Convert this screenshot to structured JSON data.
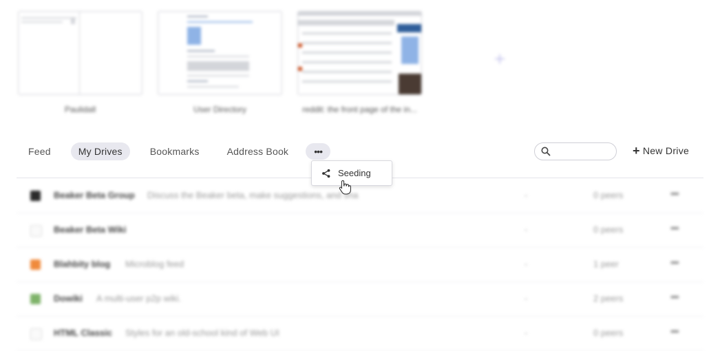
{
  "thumbnails": [
    {
      "label": "Paulidall"
    },
    {
      "label": "User Directory"
    },
    {
      "label": "reddit: the front page of the in..."
    }
  ],
  "add_thumbnail_icon": "plus-icon",
  "nav": {
    "tabs": [
      "Feed",
      "My Drives",
      "Bookmarks",
      "Address Book"
    ],
    "active": "My Drives",
    "more_icon": "•••"
  },
  "search": {
    "placeholder": ""
  },
  "new_drive": {
    "plus": "+",
    "label": "New Drive"
  },
  "dropdown": {
    "items": [
      {
        "icon": "share-icon",
        "label": "Seeding"
      }
    ]
  },
  "drives": [
    {
      "title": "Beaker Beta Group",
      "description": "Discuss the Beaker beta, make suggestions, and sha",
      "dash": "-",
      "peers": "0 peers",
      "menu": "•••",
      "icon_color": "#2b2b2b"
    },
    {
      "title": "Beaker Beta Wiki",
      "description": "",
      "dash": "-",
      "peers": "0 peers",
      "menu": "•••",
      "icon_color": "#f0f0f0"
    },
    {
      "title": "Blahbity blog",
      "description": "Microblog feed",
      "dash": "-",
      "peers": "1 peer",
      "menu": "•••",
      "icon_color": "#f08a3c"
    },
    {
      "title": "Dowiki",
      "description": "A multi-user p2p wiki.",
      "dash": "-",
      "peers": "2 peers",
      "menu": "•••",
      "icon_color": "#7fb36a"
    },
    {
      "title": "HTML Classic",
      "description": "Styles for an old-school kind of Web UI",
      "dash": "-",
      "peers": "0 peers",
      "menu": "•••",
      "icon_color": "#f0f0f0"
    }
  ],
  "colors": {
    "accent": "#e8e8ef",
    "add_icon": "#c9c8ee"
  }
}
